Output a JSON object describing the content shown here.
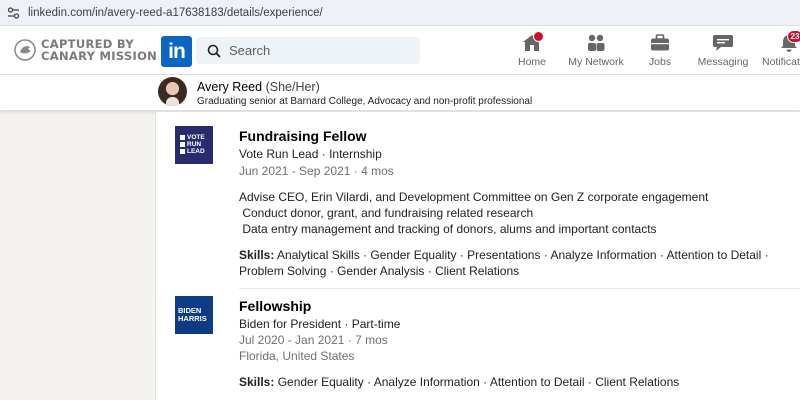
{
  "browser": {
    "url": "linkedin.com/in/avery-reed-a17638183/details/experience/"
  },
  "overlay": {
    "line1": "CAPTURED BY",
    "line2": "CANARY MISSION"
  },
  "nav": {
    "logo": "in",
    "search_placeholder": "Search",
    "items": [
      {
        "label": "Home",
        "icon": "home-icon"
      },
      {
        "label": "My Network",
        "icon": "network-icon"
      },
      {
        "label": "Jobs",
        "icon": "briefcase-icon"
      },
      {
        "label": "Messaging",
        "icon": "messaging-icon"
      },
      {
        "label": "Notifications",
        "icon": "bell-icon",
        "badge": "23"
      }
    ],
    "accent": "#0a66c2",
    "badge_color": "#cb112d"
  },
  "profile": {
    "name": "Avery Reed",
    "pronouns": "(She/Her)",
    "headline": "Graduating senior at Barnard College, Advocacy and non-profit professional"
  },
  "experience": [
    {
      "logo_text": [
        "VOTE",
        "RUN",
        "LEAD"
      ],
      "logo_color": "#2a2a6e",
      "title": "Fundraising Fellow",
      "company": "Vote Run Lead · Internship",
      "dates": "Jun 2021 - Sep 2021 · 4 mos",
      "description": [
        "Advise CEO, Erin Vilardi, and Development Committee on Gen Z corporate engagement",
        " Conduct donor, grant, and fundraising related research",
        " Data entry management and tracking of donors, alums and important contacts"
      ],
      "skills_label": "Skills:",
      "skills": "Analytical Skills · Gender Equality · Presentations · Analyze Information · Attention to Detail · Problem Solving · Gender Analysis · Client Relations"
    },
    {
      "logo_text": [
        "BIDEN",
        "HARRIS"
      ],
      "logo_color": "#0d3b86",
      "title": "Fellowship",
      "company": "Biden for President · Part-time",
      "dates": "Jul 2020 - Jan 2021 · 7 mos",
      "location": "Florida, United States",
      "skills_label": "Skills:",
      "skills": "Gender Equality · Analyze Information · Attention to Detail · Client Relations"
    }
  ]
}
